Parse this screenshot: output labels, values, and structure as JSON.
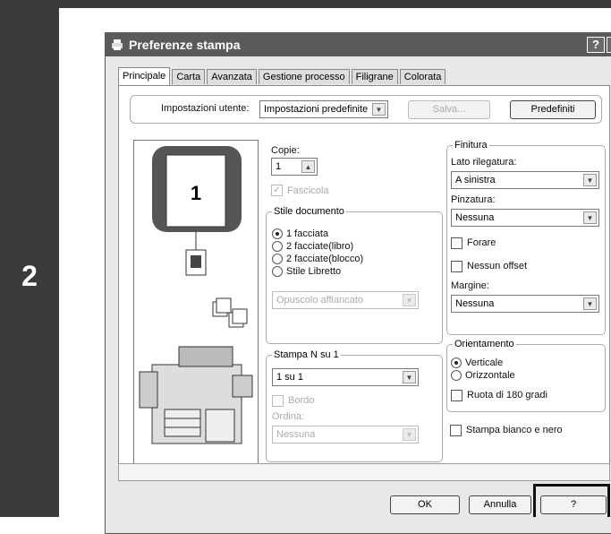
{
  "step": {
    "number": "2"
  },
  "dialog": {
    "title": "Preferenze stampa",
    "help_btn": "?",
    "close_btn": "X",
    "tabs": [
      "Principale",
      "Carta",
      "Avanzata",
      "Gestione processo",
      "Filigrane",
      "Colorata"
    ],
    "user_settings": {
      "label": "Impostazioni utente:",
      "value": "Impostazioni predefinite",
      "save": "Salva...",
      "defaults": "Predefiniti"
    },
    "preview": {
      "page_number": "1"
    },
    "copies": {
      "label": "Copie:",
      "value": "1",
      "collate": "Fascicola"
    },
    "doc_style": {
      "title": "Stile documento",
      "options": [
        "1 facciata",
        "2 facciate(libro)",
        "2 facciate(blocco)",
        "Stile Libretto"
      ],
      "booklet": "Opuscolo affiancato"
    },
    "nup": {
      "title": "Stampa N su 1",
      "value": "1 su 1",
      "border": "Bordo",
      "order_label": "Ordina:",
      "order_value": "Nessuna"
    },
    "finishing": {
      "title": "Finitura",
      "binding_label": "Lato rilegatura:",
      "binding_value": "A sinistra",
      "staple_label": "Pinzatura:",
      "staple_value": "Nessuna",
      "punch": "Forare",
      "no_offset": "Nessun offset",
      "margin_label": "Margine:",
      "margin_value": "Nessuna"
    },
    "orientation": {
      "title": "Orientamento",
      "portrait": "Verticale",
      "landscape": "Orizzontale",
      "rotate": "Ruota di 180 gradi"
    },
    "bw": "Stampa bianco e nero",
    "footer": {
      "ok": "OK",
      "cancel": "Annulla",
      "help": "?"
    }
  }
}
